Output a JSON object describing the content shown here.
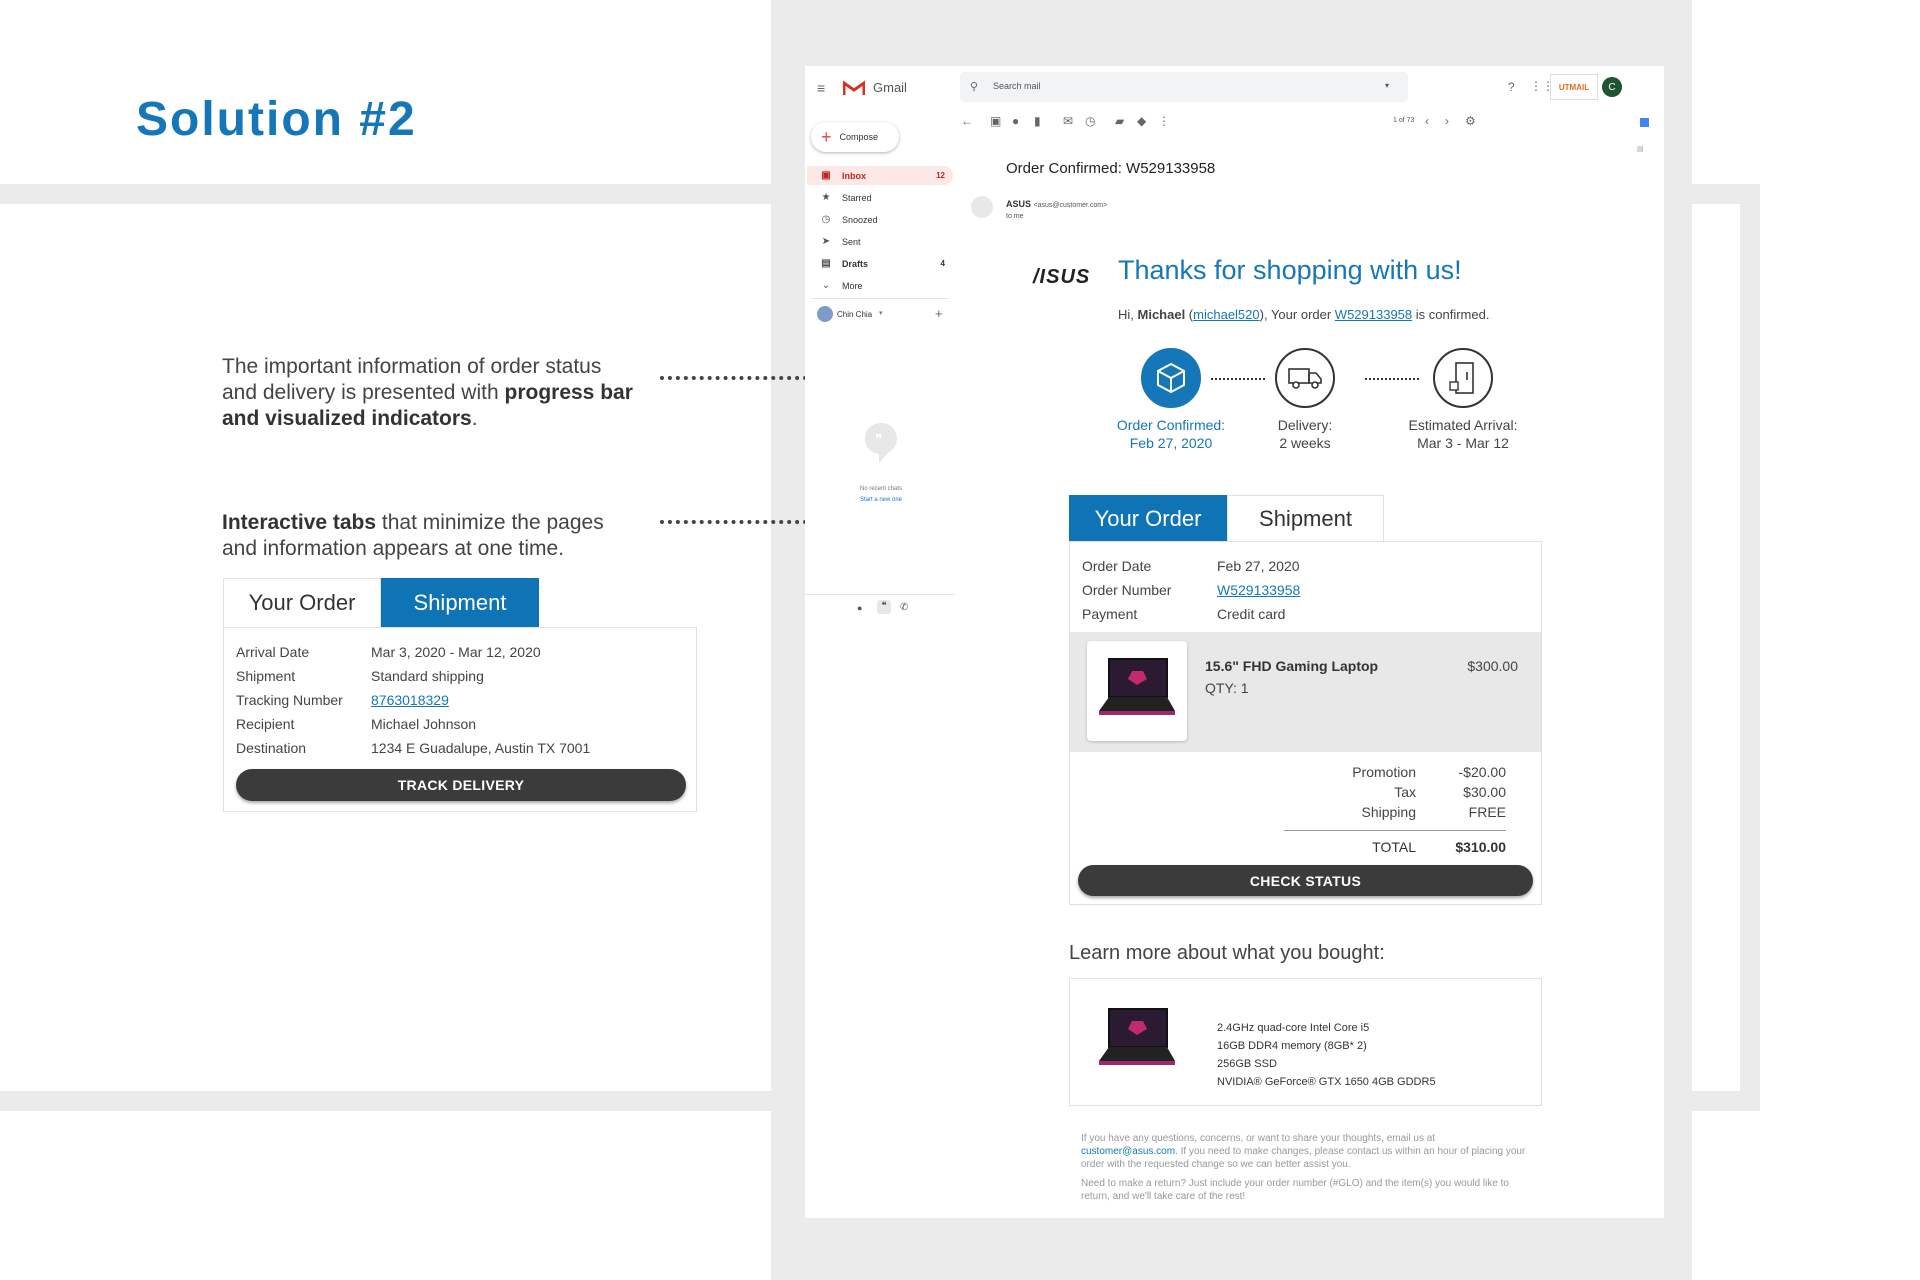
{
  "slide": {
    "title": "Solution #2",
    "note1_pre": "The important information of order status and delivery is presented with ",
    "note1_bold": "progress bar and visualized indicators",
    "note1_post": ".",
    "note2_bold": "Interactive tabs",
    "note2_post": " that minimize the pages and information appears at one time."
  },
  "demo": {
    "tabs": [
      "Your Order",
      "Shipment"
    ],
    "active_tab": "Shipment",
    "rows": [
      {
        "k": "Arrival Date",
        "v": "Mar 3, 2020 - Mar 12, 2020"
      },
      {
        "k": "Shipment",
        "v": "Standard shipping"
      },
      {
        "k": "Tracking Number",
        "v": "8763018329"
      },
      {
        "k": "Recipient",
        "v": "Michael Johnson"
      },
      {
        "k": "Destination",
        "v": "1234 E Guadalupe, Austin TX 7001"
      }
    ],
    "button": "TRACK DELIVERY"
  },
  "gmail": {
    "app_name": "Gmail",
    "search_placeholder": "Search mail",
    "compose": "Compose",
    "nav": [
      {
        "label": "Inbox",
        "count": "12",
        "icon": "inbox-icon",
        "glyph": "▣"
      },
      {
        "label": "Starred",
        "count": "",
        "icon": "star-icon",
        "glyph": "★"
      },
      {
        "label": "Snoozed",
        "count": "",
        "icon": "clock-icon",
        "glyph": "◷"
      },
      {
        "label": "Sent",
        "count": "",
        "icon": "send-icon",
        "glyph": "➤"
      },
      {
        "label": "Drafts",
        "count": "4",
        "icon": "draft-icon",
        "glyph": "▤"
      },
      {
        "label": "More",
        "count": "",
        "icon": "chevron-down-icon",
        "glyph": "⌄"
      }
    ],
    "account_name": "Chin Chia",
    "no_chats": "No recent chats",
    "start_chat": "Start a new one",
    "pager": "1 of 73",
    "avatar_letter": "C",
    "logo_badge": "UTMAIL",
    "subject": "Order Confirmed: W529133958",
    "sender_name": "ASUS",
    "sender_email": "<asus@customer.com>",
    "to": "to me"
  },
  "email": {
    "brand": "/ISUS",
    "headline": "Thanks for shopping with us!",
    "greeting_pre": "Hi, ",
    "greeting_name": "Michael",
    "greeting_user": "michael520",
    "greeting_mid": "), Your order ",
    "order_link": "W529133958",
    "greeting_post": " is confirmed.",
    "steps": [
      {
        "label": "Order Confirmed:",
        "value": "Feb 27, 2020"
      },
      {
        "label": "Delivery:",
        "value": "2 weeks"
      },
      {
        "label": "Estimated Arrival:",
        "value": "Mar 3 - Mar 12"
      }
    ],
    "tabs": [
      "Your Order",
      "Shipment"
    ],
    "active_tab": "Your Order",
    "order_rows": [
      {
        "k": "Order Date",
        "v": "Feb 27, 2020"
      },
      {
        "k": "Order Number",
        "v": "W529133958"
      },
      {
        "k": "Payment",
        "v": "Credit card"
      }
    ],
    "product_name": "15.6\" FHD Gaming Laptop",
    "product_qty": "QTY: 1",
    "product_price": "$300.00",
    "totals": [
      {
        "k": "Promotion",
        "v": "-$20.00"
      },
      {
        "k": "Tax",
        "v": "$30.00"
      },
      {
        "k": "Shipping",
        "v": "FREE"
      }
    ],
    "total_label": "TOTAL",
    "total_value": "$310.00",
    "check_status": "CHECK STATUS",
    "learn_more": "Learn more about what you bought:",
    "specs": [
      "2.4GHz quad-core Intel Core i5",
      "16GB DDR4 memory (8GB* 2)",
      "256GB SSD",
      "NVIDIA® GeForce® GTX 1650 4GB GDDR5"
    ],
    "footer1_pre": "If you have any questions, concerns, or want to share your thoughts, email us at ",
    "footer1_link": "customer@asus.com",
    "footer1_post": ". If you need to make changes, please contact us within an hour of placing your order with the requested change so we can better assist you.",
    "footer2": "Need to make a return? Just include your order number (#GLO) and the item(s) you would like to return, and we'll take care of the rest!"
  },
  "colors": {
    "accent": "#1577b8",
    "tab_active": "#0f74b6",
    "dark_button": "#3b3b3b",
    "inbox_red": "#c5221f"
  }
}
